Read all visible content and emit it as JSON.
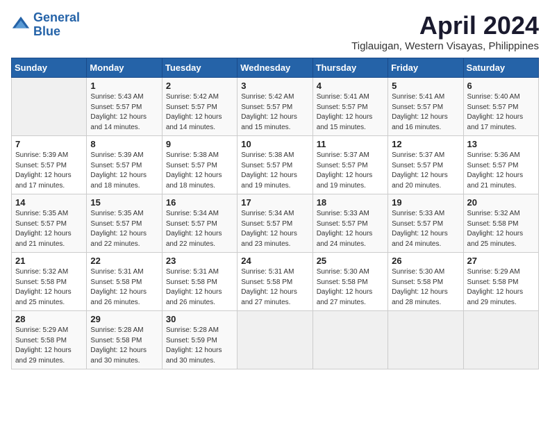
{
  "header": {
    "logo_line1": "General",
    "logo_line2": "Blue",
    "month": "April 2024",
    "location": "Tiglauigan, Western Visayas, Philippines"
  },
  "weekdays": [
    "Sunday",
    "Monday",
    "Tuesday",
    "Wednesday",
    "Thursday",
    "Friday",
    "Saturday"
  ],
  "weeks": [
    [
      {
        "day": "",
        "info": ""
      },
      {
        "day": "1",
        "info": "Sunrise: 5:43 AM\nSunset: 5:57 PM\nDaylight: 12 hours\nand 14 minutes."
      },
      {
        "day": "2",
        "info": "Sunrise: 5:42 AM\nSunset: 5:57 PM\nDaylight: 12 hours\nand 14 minutes."
      },
      {
        "day": "3",
        "info": "Sunrise: 5:42 AM\nSunset: 5:57 PM\nDaylight: 12 hours\nand 15 minutes."
      },
      {
        "day": "4",
        "info": "Sunrise: 5:41 AM\nSunset: 5:57 PM\nDaylight: 12 hours\nand 15 minutes."
      },
      {
        "day": "5",
        "info": "Sunrise: 5:41 AM\nSunset: 5:57 PM\nDaylight: 12 hours\nand 16 minutes."
      },
      {
        "day": "6",
        "info": "Sunrise: 5:40 AM\nSunset: 5:57 PM\nDaylight: 12 hours\nand 17 minutes."
      }
    ],
    [
      {
        "day": "7",
        "info": "Sunrise: 5:39 AM\nSunset: 5:57 PM\nDaylight: 12 hours\nand 17 minutes."
      },
      {
        "day": "8",
        "info": "Sunrise: 5:39 AM\nSunset: 5:57 PM\nDaylight: 12 hours\nand 18 minutes."
      },
      {
        "day": "9",
        "info": "Sunrise: 5:38 AM\nSunset: 5:57 PM\nDaylight: 12 hours\nand 18 minutes."
      },
      {
        "day": "10",
        "info": "Sunrise: 5:38 AM\nSunset: 5:57 PM\nDaylight: 12 hours\nand 19 minutes."
      },
      {
        "day": "11",
        "info": "Sunrise: 5:37 AM\nSunset: 5:57 PM\nDaylight: 12 hours\nand 19 minutes."
      },
      {
        "day": "12",
        "info": "Sunrise: 5:37 AM\nSunset: 5:57 PM\nDaylight: 12 hours\nand 20 minutes."
      },
      {
        "day": "13",
        "info": "Sunrise: 5:36 AM\nSunset: 5:57 PM\nDaylight: 12 hours\nand 21 minutes."
      }
    ],
    [
      {
        "day": "14",
        "info": "Sunrise: 5:35 AM\nSunset: 5:57 PM\nDaylight: 12 hours\nand 21 minutes."
      },
      {
        "day": "15",
        "info": "Sunrise: 5:35 AM\nSunset: 5:57 PM\nDaylight: 12 hours\nand 22 minutes."
      },
      {
        "day": "16",
        "info": "Sunrise: 5:34 AM\nSunset: 5:57 PM\nDaylight: 12 hours\nand 22 minutes."
      },
      {
        "day": "17",
        "info": "Sunrise: 5:34 AM\nSunset: 5:57 PM\nDaylight: 12 hours\nand 23 minutes."
      },
      {
        "day": "18",
        "info": "Sunrise: 5:33 AM\nSunset: 5:57 PM\nDaylight: 12 hours\nand 24 minutes."
      },
      {
        "day": "19",
        "info": "Sunrise: 5:33 AM\nSunset: 5:57 PM\nDaylight: 12 hours\nand 24 minutes."
      },
      {
        "day": "20",
        "info": "Sunrise: 5:32 AM\nSunset: 5:58 PM\nDaylight: 12 hours\nand 25 minutes."
      }
    ],
    [
      {
        "day": "21",
        "info": "Sunrise: 5:32 AM\nSunset: 5:58 PM\nDaylight: 12 hours\nand 25 minutes."
      },
      {
        "day": "22",
        "info": "Sunrise: 5:31 AM\nSunset: 5:58 PM\nDaylight: 12 hours\nand 26 minutes."
      },
      {
        "day": "23",
        "info": "Sunrise: 5:31 AM\nSunset: 5:58 PM\nDaylight: 12 hours\nand 26 minutes."
      },
      {
        "day": "24",
        "info": "Sunrise: 5:31 AM\nSunset: 5:58 PM\nDaylight: 12 hours\nand 27 minutes."
      },
      {
        "day": "25",
        "info": "Sunrise: 5:30 AM\nSunset: 5:58 PM\nDaylight: 12 hours\nand 27 minutes."
      },
      {
        "day": "26",
        "info": "Sunrise: 5:30 AM\nSunset: 5:58 PM\nDaylight: 12 hours\nand 28 minutes."
      },
      {
        "day": "27",
        "info": "Sunrise: 5:29 AM\nSunset: 5:58 PM\nDaylight: 12 hours\nand 29 minutes."
      }
    ],
    [
      {
        "day": "28",
        "info": "Sunrise: 5:29 AM\nSunset: 5:58 PM\nDaylight: 12 hours\nand 29 minutes."
      },
      {
        "day": "29",
        "info": "Sunrise: 5:28 AM\nSunset: 5:58 PM\nDaylight: 12 hours\nand 30 minutes."
      },
      {
        "day": "30",
        "info": "Sunrise: 5:28 AM\nSunset: 5:59 PM\nDaylight: 12 hours\nand 30 minutes."
      },
      {
        "day": "",
        "info": ""
      },
      {
        "day": "",
        "info": ""
      },
      {
        "day": "",
        "info": ""
      },
      {
        "day": "",
        "info": ""
      }
    ]
  ]
}
